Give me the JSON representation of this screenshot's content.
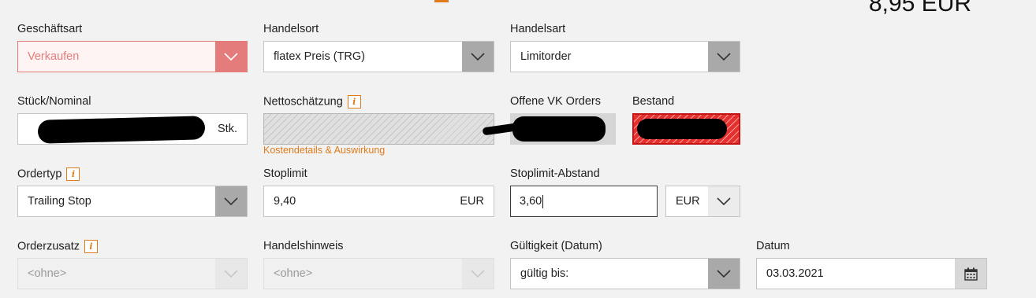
{
  "price": "8,95 EUR",
  "geschaeftsart": {
    "label": "Geschäftsart",
    "value": "Verkaufen"
  },
  "handelsort": {
    "label": "Handelsort",
    "value": "flatex Preis (TRG)"
  },
  "handelsart": {
    "label": "Handelsart",
    "value": "Limitorder"
  },
  "stueck": {
    "label": "Stück/Nominal",
    "unit": "Stk."
  },
  "nettoschaetzung": {
    "label": "Nettoschätzung",
    "link": "Kostendetails & Auswirkung"
  },
  "offene_vk": {
    "label": "Offene VK Orders"
  },
  "bestand": {
    "label": "Bestand"
  },
  "ordertyp": {
    "label": "Ordertyp",
    "value": "Trailing Stop"
  },
  "stoplimit": {
    "label": "Stoplimit",
    "value": "9,40",
    "unit": "EUR"
  },
  "stoplimit_abstand": {
    "label": "Stoplimit-Abstand",
    "value": "3,60",
    "unit_select": "EUR"
  },
  "orderzusatz": {
    "label": "Orderzusatz",
    "value": "<ohne>"
  },
  "handelshinweis": {
    "label": "Handelshinweis",
    "value": "<ohne>"
  },
  "gueltigkeit": {
    "label": "Gültigkeit (Datum)",
    "value": "gültig bis:"
  },
  "datum": {
    "label": "Datum",
    "value": "03.03.2021"
  },
  "info_glyph": "i",
  "colors": {
    "accent": "#e07b1a",
    "sell": "#e57c7c",
    "alert": "#e53030"
  }
}
